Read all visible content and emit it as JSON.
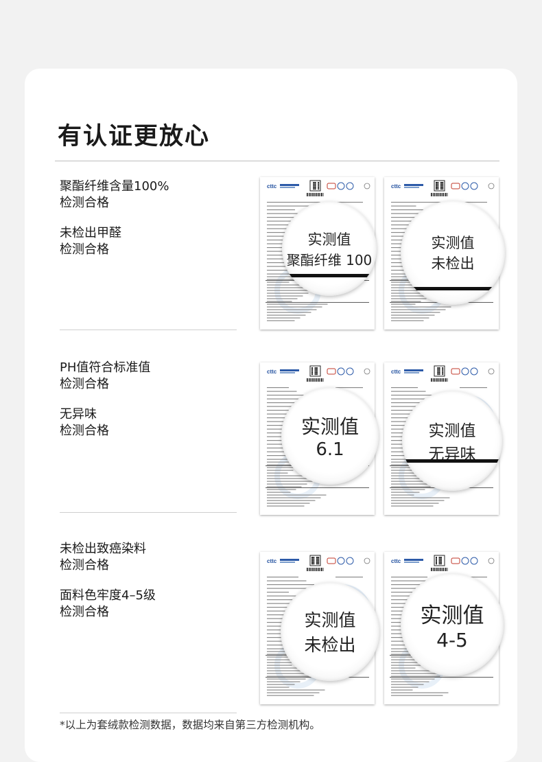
{
  "title": "有认证更放心",
  "sections": [
    {
      "claims": [
        {
          "line1": "聚酯纤维含量100%",
          "line2": "检测合格"
        },
        {
          "line1": "未检出甲醛",
          "line2": "检测合格"
        }
      ],
      "reports": [
        {
          "mag_line1": "实测值",
          "mag_line2": "聚酯纤维 100"
        },
        {
          "mag_line1": "实测值",
          "mag_line2": "未检出"
        }
      ]
    },
    {
      "claims": [
        {
          "line1": "PH值符合标准值",
          "line2": "检测合格"
        },
        {
          "line1": "无异味",
          "line2": "检测合格"
        }
      ],
      "reports": [
        {
          "mag_line1": "实测值",
          "mag_line2": "6.1"
        },
        {
          "mag_line1": "实测值",
          "mag_line2": "无异味"
        }
      ]
    },
    {
      "claims": [
        {
          "line1": "未检出致癌染料",
          "line2": "检测合格"
        },
        {
          "line1": "面料色牢度4–5级",
          "line2": "检测合格"
        }
      ],
      "reports": [
        {
          "mag_line1": "实测值",
          "mag_line2": "未检出"
        },
        {
          "mag_line1": "实测值",
          "mag_line2": "4-5"
        }
      ]
    }
  ],
  "report_logo_text": "cttc",
  "footnote": "*以上为套绒款检测数据，数据均来自第三方检测机构。"
}
